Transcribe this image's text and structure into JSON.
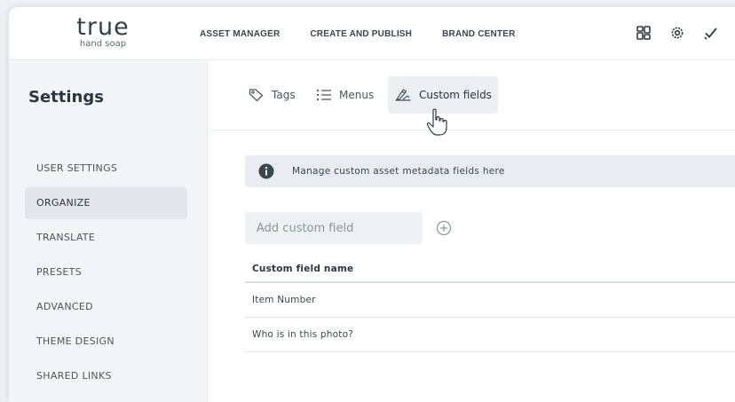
{
  "brand": {
    "name": "true",
    "tagline": "hand soap"
  },
  "topnav": {
    "items": [
      "ASSET MANAGER",
      "CREATE AND PUBLISH",
      "BRAND CENTER"
    ],
    "icons": [
      "grid-icon",
      "gear-icon",
      "checkmark-icon"
    ]
  },
  "sidebar": {
    "title": "Settings",
    "items": [
      {
        "label": "USER SETTINGS",
        "active": false
      },
      {
        "label": "ORGANIZE",
        "active": true
      },
      {
        "label": "TRANSLATE",
        "active": false
      },
      {
        "label": "PRESETS",
        "active": false
      },
      {
        "label": "ADVANCED",
        "active": false
      },
      {
        "label": "THEME DESIGN",
        "active": false
      },
      {
        "label": "SHARED LINKS",
        "active": false
      }
    ]
  },
  "tabs": [
    {
      "label": "Tags",
      "icon": "tag-icon"
    },
    {
      "label": "Menus",
      "icon": "list-icon"
    },
    {
      "label": "Custom fields",
      "icon": "pencil-ruler-icon",
      "active": true
    }
  ],
  "info": {
    "text": "Manage custom asset metadata fields here",
    "icon": "info-icon"
  },
  "add_field": {
    "placeholder": "Add custom field",
    "value": ""
  },
  "table": {
    "header": "Custom field name",
    "rows": [
      "Item Number",
      "Who is in this photo?"
    ]
  },
  "colors": {
    "accent": "#34404a",
    "sidebar_bg": "#f3f5f7",
    "active_bg": "#e3e7ec"
  }
}
